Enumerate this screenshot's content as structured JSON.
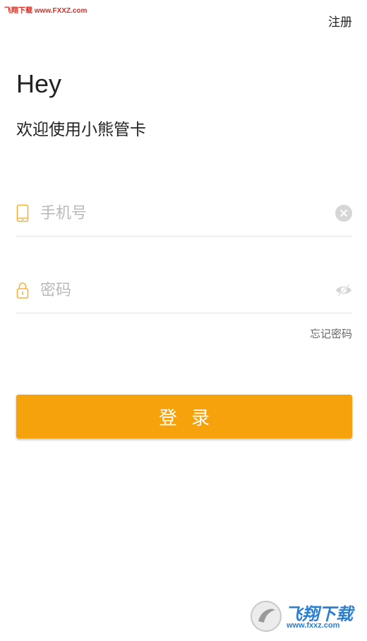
{
  "watermark": {
    "top_text": "飞翔下载 www.FXXZ.com",
    "brand": "飞翔下载",
    "url": "www.fxxz.com"
  },
  "header": {
    "register_label": "注册"
  },
  "greeting": {
    "title": "Hey",
    "subtitle": "欢迎使用小熊管卡"
  },
  "form": {
    "phone": {
      "placeholder": "手机号",
      "value": "",
      "icon": "phone-icon",
      "action_icon": "clear-icon"
    },
    "password": {
      "placeholder": "密码",
      "value": "",
      "icon": "lock-icon",
      "action_icon": "eye-hidden-icon"
    },
    "forgot_label": "忘记密码",
    "login_label": "登录"
  },
  "colors": {
    "accent": "#f6a20c",
    "icon_accent": "#f3b33d",
    "divider": "#e3e3e3"
  }
}
